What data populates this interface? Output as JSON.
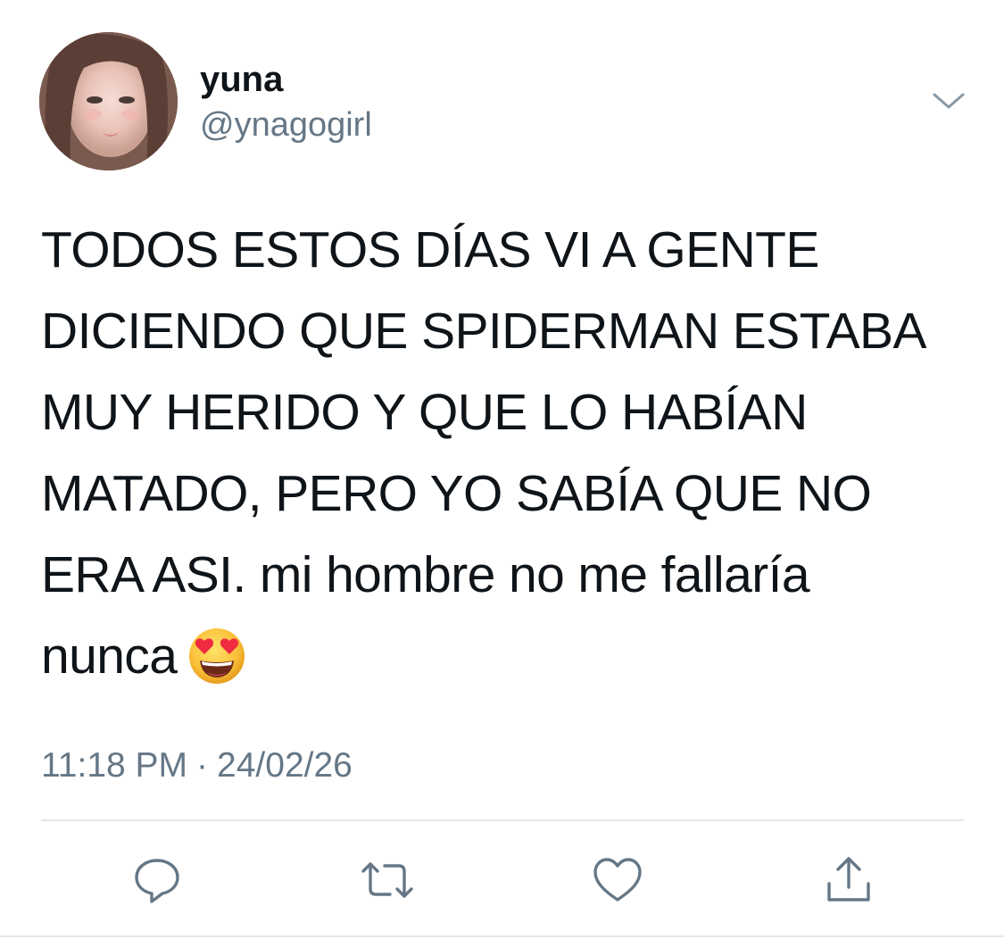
{
  "author": {
    "display_name": "yuna",
    "handle": "@ynagogirl",
    "avatar_icon": "profile-photo"
  },
  "tweet": {
    "lines": [
      "TODOS ESTOS DÍAS VI A GENTE",
      "DICIENDO QUE SPIDERMAN ESTABA",
      "MUY HERIDO Y QUE LO HABÍAN",
      "MATADO, PERO YO SABÍA QUE NO",
      "ERA ASI. mi hombre no me fallaría",
      "nunca"
    ],
    "emoji": "heart-eyes-emoji",
    "time": "11:18 PM",
    "separator": "·",
    "date": "24/02/26"
  },
  "actions": [
    {
      "name": "reply",
      "icon": "reply-icon"
    },
    {
      "name": "retweet",
      "icon": "retweet-icon"
    },
    {
      "name": "like",
      "icon": "heart-icon"
    },
    {
      "name": "share",
      "icon": "share-icon"
    }
  ],
  "colors": {
    "text": "#0f1419",
    "secondary": "#657786",
    "divider": "#e1e8ed"
  }
}
